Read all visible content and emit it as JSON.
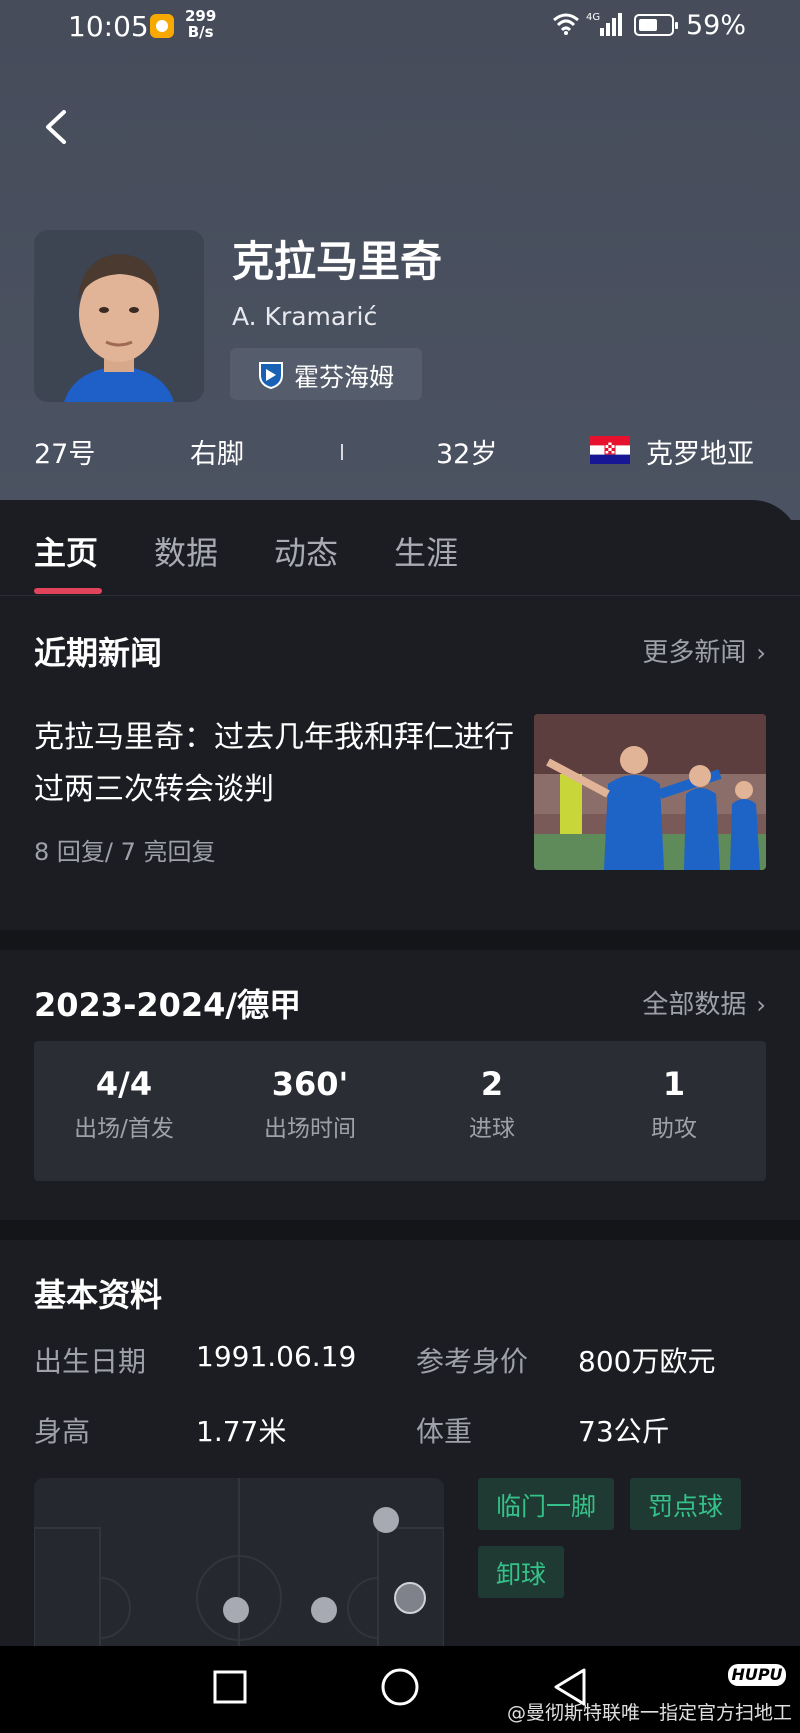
{
  "status_bar": {
    "time": "10:05",
    "net_speed_value": "299",
    "net_speed_unit": "B/s",
    "network_type": "4G",
    "battery": "59%"
  },
  "player": {
    "name_cn": "克拉马里奇",
    "name_latin": "A. Kramarić",
    "team": "霍芬海姆",
    "number": "27号",
    "foot": "右脚",
    "age": "32岁",
    "country": "克罗地亚"
  },
  "tabs": [
    {
      "label": "主页",
      "active": true
    },
    {
      "label": "数据",
      "active": false
    },
    {
      "label": "动态",
      "active": false
    },
    {
      "label": "生涯",
      "active": false
    }
  ],
  "news": {
    "title": "近期新闻",
    "more_label": "更多新闻",
    "headline": "克拉马里奇：过去几年我和拜仁进行过两三次转会谈判",
    "meta": "8 回复/ 7 亮回复"
  },
  "season": {
    "title": "2023-2024/德甲",
    "more_label": "全部数据",
    "stats": [
      {
        "value": "4/4",
        "label": "出场/首发"
      },
      {
        "value": "360'",
        "label": "出场时间"
      },
      {
        "value": "2",
        "label": "进球"
      },
      {
        "value": "1",
        "label": "助攻"
      }
    ]
  },
  "basic_info": {
    "title": "基本资料",
    "birth_label": "出生日期",
    "birth_value": "1991.06.19",
    "value_label": "参考身价",
    "value_value": "800万欧元",
    "height_label": "身高",
    "height_value": "1.77米",
    "weight_label": "体重",
    "weight_value": "73公斤",
    "traits": [
      "临门一脚",
      "罚点球",
      "卸球"
    ]
  },
  "watermark": {
    "logo": "HUPU",
    "text": "@曼彻斯特联唯一指定官方扫地工"
  },
  "colors": {
    "accent": "#e0435a",
    "trait_text": "#35c28a",
    "header_bg": "#4b5261"
  }
}
